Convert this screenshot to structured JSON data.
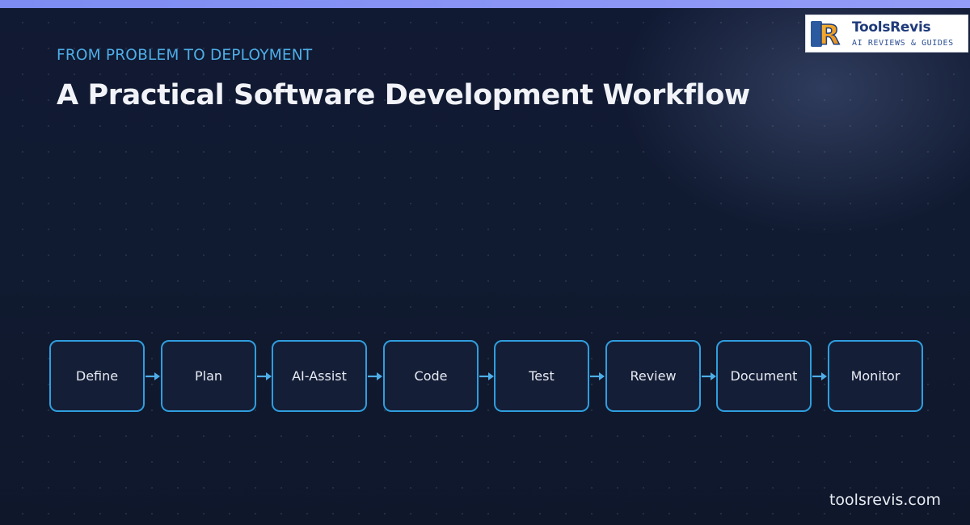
{
  "header": {
    "eyebrow": "FROM PROBLEM TO DEPLOYMENT",
    "title": "A Practical Software Development Workflow"
  },
  "logo": {
    "mark": "R",
    "name": "ToolsRevis",
    "tagline": "AI REVIEWS & GUIDES"
  },
  "workflow": {
    "steps": [
      {
        "label": "Define"
      },
      {
        "label": "Plan"
      },
      {
        "label": "AI-Assist"
      },
      {
        "label": "Code"
      },
      {
        "label": "Test"
      },
      {
        "label": "Review"
      },
      {
        "label": "Document"
      },
      {
        "label": "Monitor"
      }
    ],
    "connector_icon": "arrow-right-icon"
  },
  "footer": {
    "url": "toolsrevis.com"
  },
  "colors": {
    "background": "#0f172a",
    "accent": "#4eaee8",
    "step_border": "#2f9ede",
    "top_bar": "#8b95f5"
  }
}
